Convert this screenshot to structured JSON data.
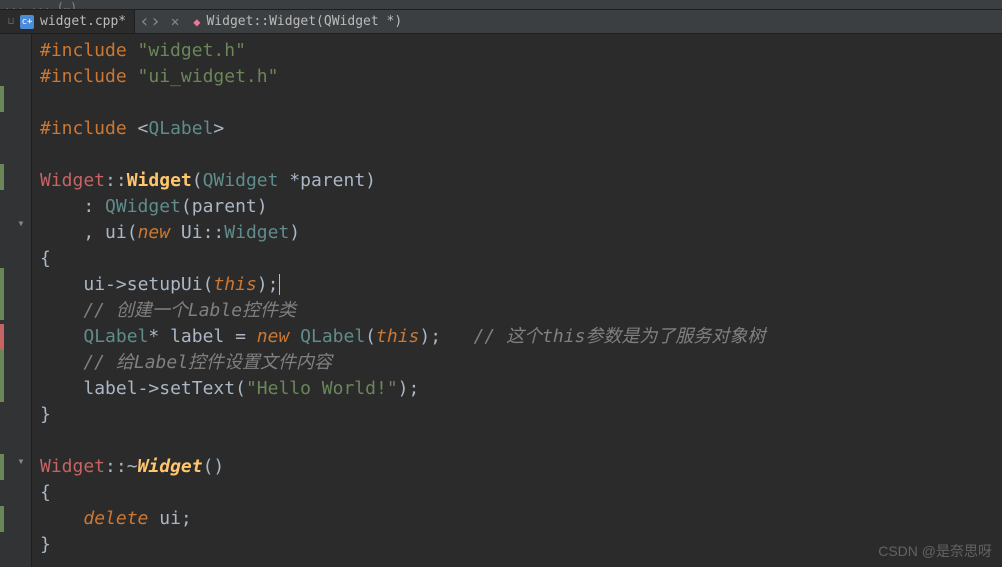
{
  "menu": {
    "truncated": "... ... (…)"
  },
  "tab": {
    "filename": "widget.cpp*"
  },
  "breadcrumb": {
    "text": "Widget::Widget(QWidget *)"
  },
  "code": {
    "l1_kw": "#include",
    "l1_str": "\"widget.h\"",
    "l2_kw": "#include",
    "l2_str": "\"ui_widget.h\"",
    "l4_kw": "#include",
    "l4_lt": "<",
    "l4_type": "QLabel",
    "l4_gt": ">",
    "l6_cls": "Widget",
    "l6_sep": "::",
    "l6_ctor": "Widget",
    "l6_lp": "(",
    "l6_ptype": "QWidget",
    "l6_star": " *",
    "l6_param": "parent",
    "l6_rp": ")",
    "l7_colon": "    : ",
    "l7_base": "QWidget",
    "l7_lp": "(",
    "l7_arg": "parent",
    "l7_rp": ")",
    "l8_comma": "    , ",
    "l8_mem": "ui",
    "l8_lp": "(",
    "l8_new": "new",
    "l8_ns": " Ui::",
    "l8_type": "Widget",
    "l8_rp": ")",
    "l9": "{",
    "l10_indent": "    ",
    "l10_obj": "ui",
    "l10_arrow": "->",
    "l10_fn": "setupUi",
    "l10_lp": "(",
    "l10_this": "this",
    "l10_rp": ");",
    "l11": "    // 创建一个Lable控件类",
    "l12_indent": "    ",
    "l12_type": "QLabel",
    "l12_star": "* ",
    "l12_var": "label",
    "l12_eq": " = ",
    "l12_new": "new",
    "l12_sp": " ",
    "l12_ctor": "QLabel",
    "l12_lp": "(",
    "l12_this": "this",
    "l12_rp": ");",
    "l12_cmt": "   // 这个this参数是为了服务对象树",
    "l13": "    // 给Label控件设置文件内容",
    "l14_indent": "    ",
    "l14_obj": "label",
    "l14_arrow": "->",
    "l14_fn": "setText",
    "l14_lp": "(",
    "l14_str": "\"Hello World!\"",
    "l14_rp": ");",
    "l15": "}",
    "l17_cls": "Widget",
    "l17_sep": "::",
    "l17_tilde": "~",
    "l17_dtor": "Widget",
    "l17_pr": "()",
    "l18": "{",
    "l19_indent": "    ",
    "l19_del": "delete",
    "l19_sp": " ",
    "l19_obj": "ui",
    "l19_semi": ";",
    "l20": "}"
  },
  "watermark": "CSDN @是奈思呀"
}
